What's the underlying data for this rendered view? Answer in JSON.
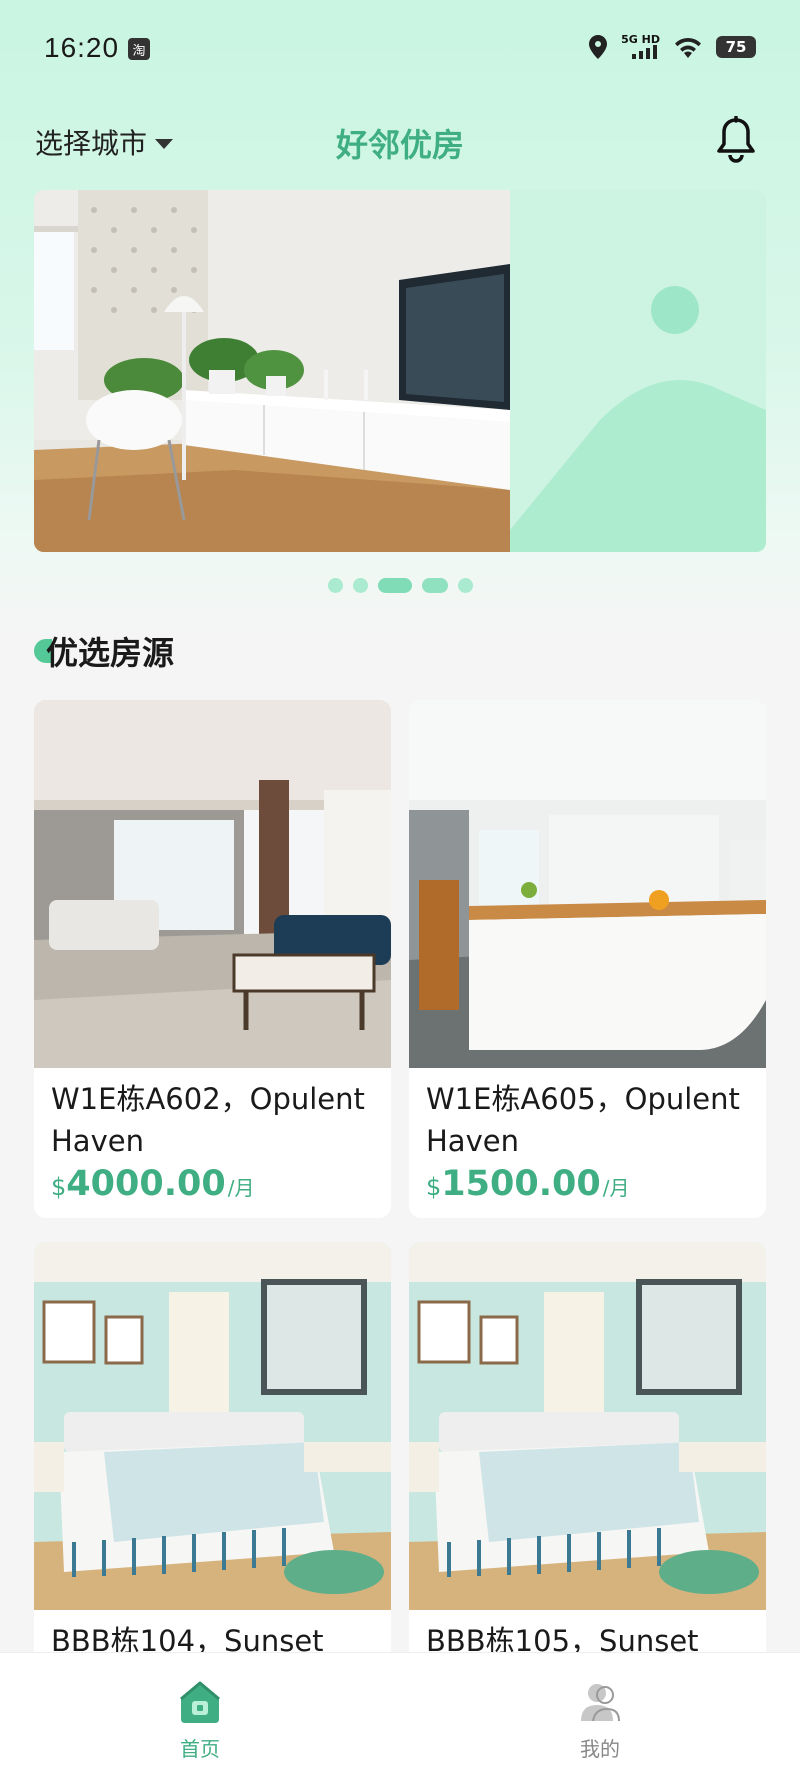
{
  "status_bar": {
    "time": "16:20",
    "app_badge": "淘",
    "network": "5G HD",
    "battery": "75"
  },
  "header": {
    "city_label": "选择城市",
    "title": "好邻优房"
  },
  "banner": {
    "dot_count": 5,
    "active_index": 2
  },
  "section": {
    "title": "优选房源"
  },
  "listings": [
    {
      "title": "W1E栋A602，Opulent Haven",
      "currency": "$",
      "price": "4000.00",
      "unit": "/月"
    },
    {
      "title": "W1E栋A605，Opulent Haven",
      "currency": "$",
      "price": "1500.00",
      "unit": "/月"
    },
    {
      "title": "BBB栋104，Sunset",
      "currency": "",
      "price": "",
      "unit": ""
    },
    {
      "title": "BBB栋105，Sunset",
      "currency": "",
      "price": "",
      "unit": ""
    }
  ],
  "bottom_nav": {
    "home_label": "首页",
    "me_label": "我的"
  },
  "colors": {
    "accent": "#3fae83",
    "header_bg": "#c9f5e2",
    "page_bg": "#f5f5f5"
  }
}
